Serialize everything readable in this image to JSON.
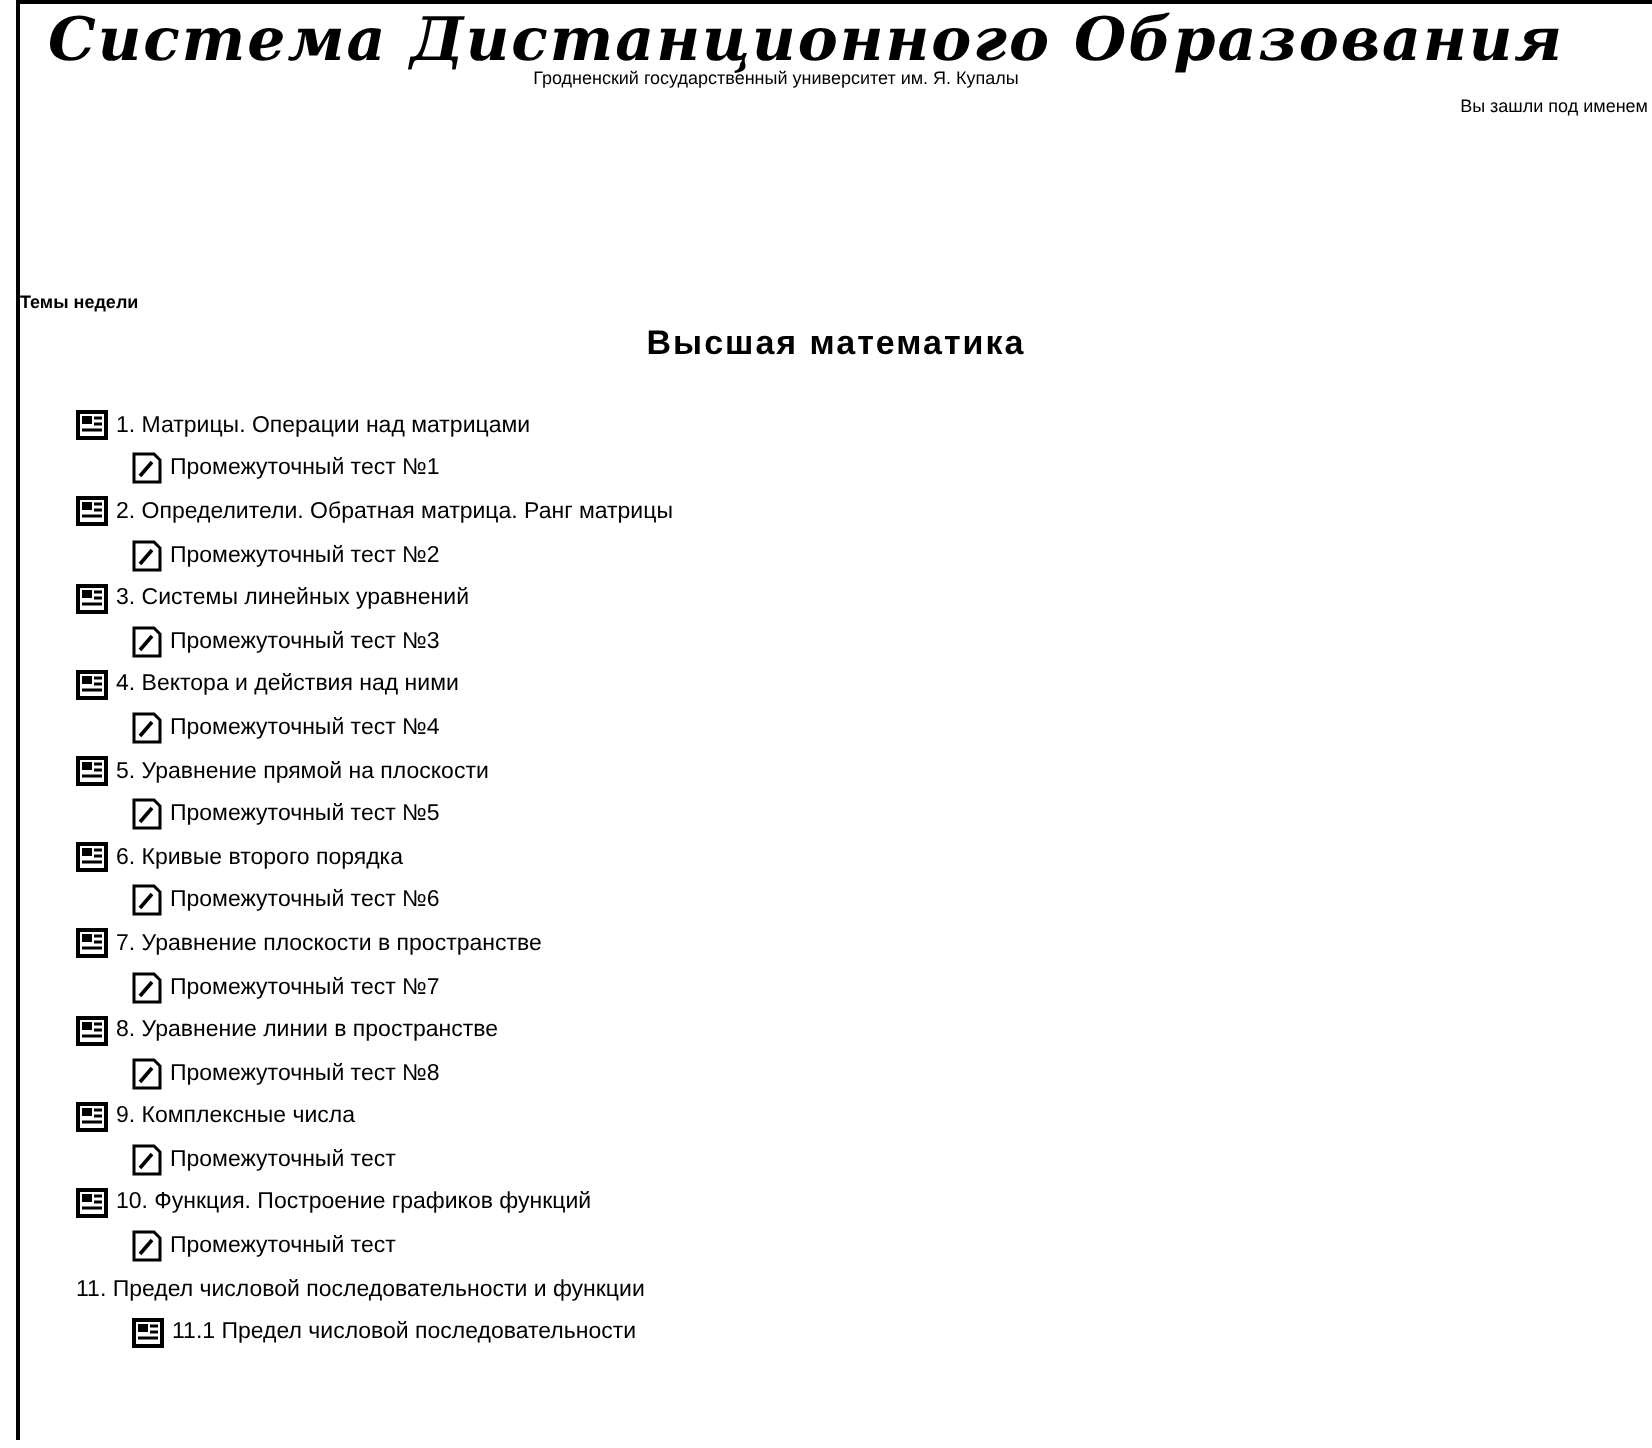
{
  "header": {
    "title": "Система Дистанционного Образования",
    "subtitle": "Гродненский государственный университет им. Я. Купалы",
    "login_note": "Вы зашли под именем"
  },
  "section_label": "Темы недели",
  "course_title": "Высшая математика",
  "topics": [
    {
      "kind": "module",
      "label": "1. Матрицы. Операции над матрицами",
      "children": [
        {
          "kind": "quiz",
          "label": "Промежуточный тест №1"
        }
      ]
    },
    {
      "kind": "module",
      "label": "2. Определители. Обратная матрица. Ранг матрицы",
      "children": [
        {
          "kind": "quiz",
          "label": "Промежуточный тест №2"
        }
      ]
    },
    {
      "kind": "module",
      "label": "3. Системы линейных уравнений",
      "children": [
        {
          "kind": "quiz",
          "label": "Промежуточный тест №3"
        }
      ]
    },
    {
      "kind": "module",
      "label": "4. Вектора и действия над ними",
      "children": [
        {
          "kind": "quiz",
          "label": "Промежуточный тест №4"
        }
      ]
    },
    {
      "kind": "module",
      "label": "5. Уравнение прямой на плоскости",
      "children": [
        {
          "kind": "quiz",
          "label": "Промежуточный тест №5"
        }
      ]
    },
    {
      "kind": "module",
      "label": "6. Кривые второго порядка",
      "children": [
        {
          "kind": "quiz",
          "label": "Промежуточный тест №6"
        }
      ]
    },
    {
      "kind": "module",
      "label": "7. Уравнение плоскости в пространстве",
      "children": [
        {
          "kind": "quiz",
          "label": "Промежуточный тест №7"
        }
      ]
    },
    {
      "kind": "module",
      "label": "8. Уравнение линии в пространстве",
      "children": [
        {
          "kind": "quiz",
          "label": "Промежуточный тест №8"
        }
      ]
    },
    {
      "kind": "module",
      "label": "9. Комплексные числа",
      "children": [
        {
          "kind": "quiz",
          "label": "Промежуточный тест"
        }
      ]
    },
    {
      "kind": "module",
      "label": "10. Функция. Построение графиков функций",
      "children": [
        {
          "kind": "quiz",
          "label": "Промежуточный тест"
        }
      ]
    },
    {
      "kind": "section",
      "label": "11. Предел числовой последовательности и функции",
      "children": [
        {
          "kind": "module",
          "label": "11.1 Предел числовой последовательности"
        }
      ]
    }
  ]
}
